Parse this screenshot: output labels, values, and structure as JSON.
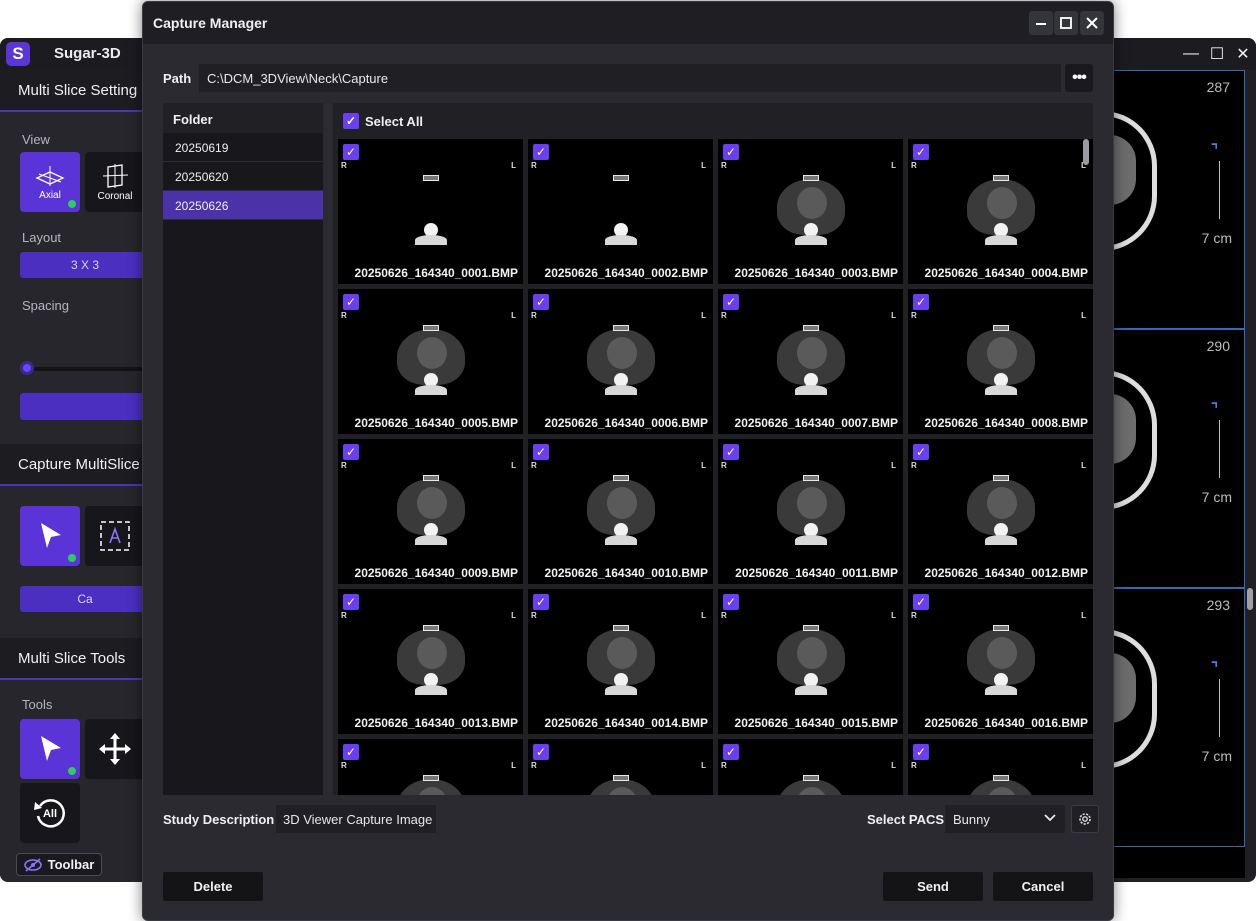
{
  "app": {
    "logo": "S",
    "title": "Sugar-3D",
    "sections": {
      "multi_slice_setting": "Multi Slice Setting",
      "capture_multislice": "Capture MultiSlice",
      "multi_slice_tools": "Multi Slice Tools"
    },
    "labels": {
      "view": "View",
      "layout": "Layout",
      "spacing": "Spacing",
      "tools": "Tools"
    },
    "view_buttons": {
      "axial": "Axial",
      "coronal": "Coronal"
    },
    "layout_value": "3 X 3",
    "capture_button_partial": "Ca",
    "rotate_all_label": "All",
    "toolbar_toggle": "Toolbar",
    "viewports": [
      {
        "slice": "287",
        "scale": "7 cm"
      },
      {
        "slice": "290",
        "scale": "7 cm"
      },
      {
        "slice": "293",
        "scale": "7 cm"
      }
    ]
  },
  "dialog": {
    "title": "Capture Manager",
    "path_label": "Path",
    "path_value": "C:\\DCM_3DView\\Neck\\Capture",
    "folder_header": "Folder",
    "folders": [
      {
        "name": "20250619",
        "selected": false
      },
      {
        "name": "20250620",
        "selected": false
      },
      {
        "name": "20250626",
        "selected": true
      }
    ],
    "select_all_label": "Select All",
    "orientation_left": "R",
    "orientation_right": "L",
    "images": [
      "20250626_164340_0001.BMP",
      "20250626_164340_0002.BMP",
      "20250626_164340_0003.BMP",
      "20250626_164340_0004.BMP",
      "20250626_164340_0005.BMP",
      "20250626_164340_0006.BMP",
      "20250626_164340_0007.BMP",
      "20250626_164340_0008.BMP",
      "20250626_164340_0009.BMP",
      "20250626_164340_0010.BMP",
      "20250626_164340_0011.BMP",
      "20250626_164340_0012.BMP",
      "20250626_164340_0013.BMP",
      "20250626_164340_0014.BMP",
      "20250626_164340_0015.BMP",
      "20250626_164340_0016.BMP",
      "",
      "",
      "",
      ""
    ],
    "study_description_label": "Study Description",
    "study_description_value": "3D Viewer Capture Image",
    "select_pacs_label": "Select PACS",
    "pacs_value": "Bunny",
    "buttons": {
      "delete": "Delete",
      "send": "Send",
      "cancel": "Cancel"
    }
  },
  "colors": {
    "accent": "#5a34d6",
    "status_dot": "#2fce58",
    "viewport_border": "#2f6db8"
  },
  "icons": [
    "close-icon",
    "maximize-icon",
    "minimize-icon",
    "more-icon",
    "checkbox-checked-icon",
    "chevron-down-icon",
    "gear-icon",
    "pointer-icon",
    "move-icon",
    "rotate-reset-icon",
    "eye-slash-icon"
  ]
}
